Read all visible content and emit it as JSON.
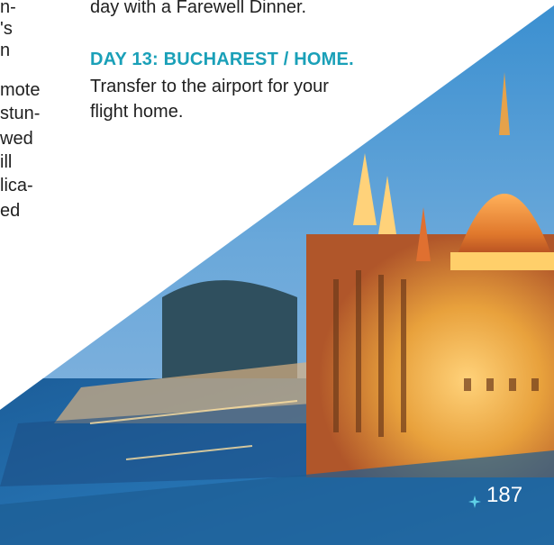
{
  "left_fragments": [
    "n-",
    "'s",
    "n",
    "mote",
    "stun-",
    "wed",
    "ill",
    "lica-",
    "ed"
  ],
  "intro_tail": "day with a Farewell Dinner.",
  "day13": {
    "heading": "DAY 13: BUCHAREST / HOME.",
    "lines": [
      "Transfer to the airport for your",
      "flight home."
    ]
  },
  "page_number": "187",
  "colors": {
    "accent": "#1aa0b8",
    "text": "#1f1f1f"
  },
  "image": {
    "subject": "Hungarian Parliament Building illuminated at dusk beside the Danube"
  },
  "icons": {
    "page_marker": "compass-star-icon"
  }
}
